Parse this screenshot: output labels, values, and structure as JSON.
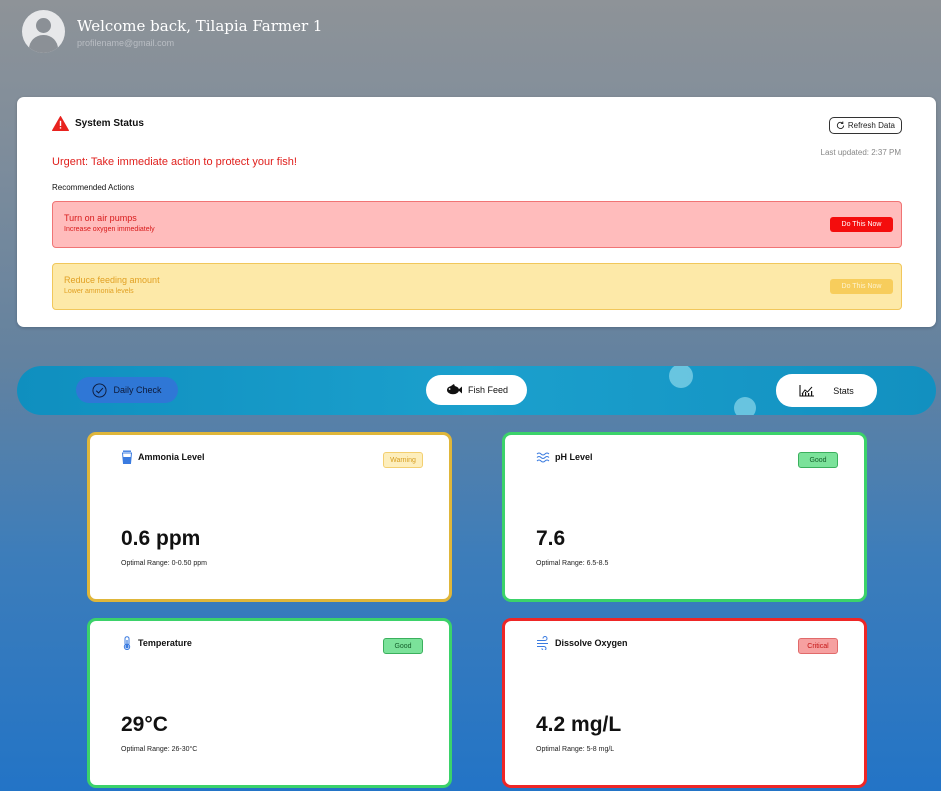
{
  "user": {
    "welcome": "Welcome back, Tilapia Farmer 1",
    "email": "profilename@gmail.com"
  },
  "status": {
    "title": "System Status",
    "refresh_label": "Refresh Data",
    "last_updated": "Last updated: 2:37 PM",
    "urgent_message": "Urgent: Take immediate action to protect your fish!",
    "recommended_label": "Recommended Actions",
    "actions": [
      {
        "title": "Turn on air pumps",
        "subtitle": "Increase oxygen immediately",
        "button": "Do This Now",
        "severity": "critical"
      },
      {
        "title": "Reduce feeding amount",
        "subtitle": "Lower ammonia levels",
        "button": "Do This Now",
        "severity": "warning"
      }
    ]
  },
  "nav": {
    "items": [
      {
        "label": "Daily Check",
        "icon": "check-circle-icon",
        "active": true
      },
      {
        "label": "Fish Feed",
        "icon": "fish-icon",
        "active": false
      },
      {
        "label": "Stats",
        "icon": "line-chart-icon",
        "active": false
      }
    ]
  },
  "metrics": [
    {
      "name": "Ammonia Level",
      "icon": "flask-icon",
      "status": "Warning",
      "value": "0.6 ppm",
      "range": "Optimal Range: 0-0.50 ppm"
    },
    {
      "name": "pH Level",
      "icon": "waves-icon",
      "status": "Good",
      "value": "7.6",
      "range": "Optimal Range: 6.5-8.5"
    },
    {
      "name": "Temperature",
      "icon": "thermometer-icon",
      "status": "Good",
      "value": "29°C",
      "range": "Optimal Range: 26-30°C"
    },
    {
      "name": "Dissolve Oxygen",
      "icon": "wind-icon",
      "status": "Critical",
      "value": "4.2 mg/L",
      "range": "Optimal Range:  5-8 mg/L"
    }
  ],
  "colors": {
    "critical": "#f40d0d",
    "warning": "#dfb63a",
    "good": "#3bd26a",
    "nav_active": "#2f77d6"
  }
}
